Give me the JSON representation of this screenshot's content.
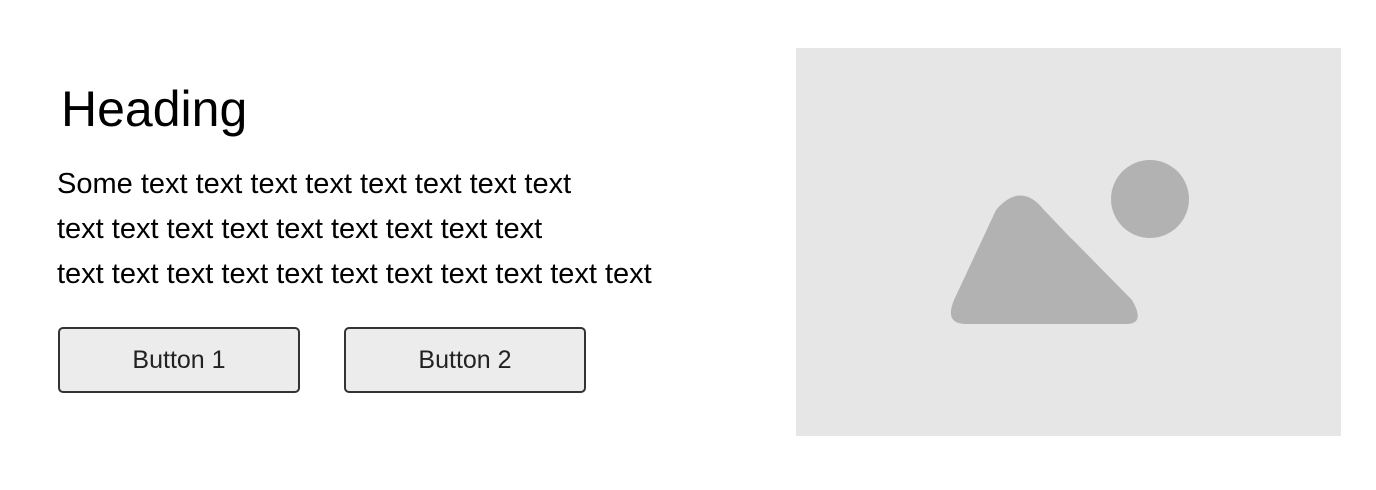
{
  "content": {
    "heading": "Heading",
    "text_lines": [
      "Some text text text text text text text text",
      "text text text text text text text text text",
      "text text text text text text text text text text text"
    ]
  },
  "buttons": {
    "button_1_label": "Button 1",
    "button_2_label": "Button 2"
  },
  "image": {
    "icon": "image-placeholder-icon",
    "background_color": "#e6e6e6",
    "icon_color": "#b2b2b2"
  }
}
